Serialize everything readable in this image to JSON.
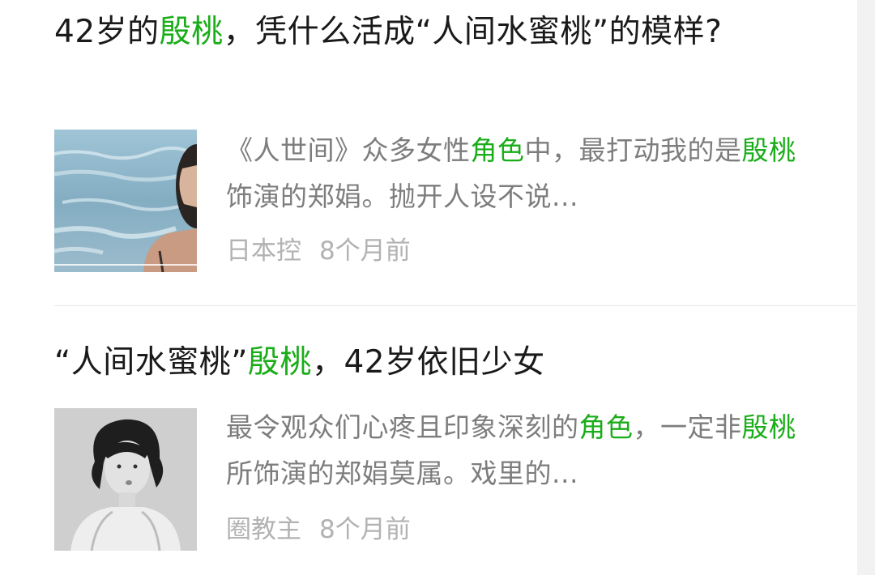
{
  "articles": [
    {
      "title_parts": [
        {
          "text": "42岁的",
          "hl": false
        },
        {
          "text": "殷桃",
          "hl": true
        },
        {
          "text": "，凭什么活成“人间水蜜桃”的模样?",
          "hl": false
        }
      ],
      "summary_parts": [
        {
          "text": "《人世间》众多女性",
          "hl": false
        },
        {
          "text": "角色",
          "hl": true
        },
        {
          "text": "中，最打动我的是",
          "hl": false
        },
        {
          "text": "殷桃",
          "hl": true
        },
        {
          "text": "饰演的郑娟。抛开人设不说...",
          "hl": false
        }
      ],
      "source": "日本控",
      "time": "8个月前",
      "thumb_icon": "beach-photo-thumbnail"
    },
    {
      "title_parts": [
        {
          "text": "“人间水蜜桃”",
          "hl": false
        },
        {
          "text": "殷桃",
          "hl": true
        },
        {
          "text": "，42岁依旧少女",
          "hl": false
        }
      ],
      "summary_parts": [
        {
          "text": "最令观众们心疼且印象深刻的",
          "hl": false
        },
        {
          "text": "角色",
          "hl": true
        },
        {
          "text": "，一定非",
          "hl": false
        },
        {
          "text": "殷桃",
          "hl": true
        },
        {
          "text": "所饰演的郑娟莫属。戏里的...",
          "hl": false
        }
      ],
      "source": "圈教主",
      "time": "8个月前",
      "thumb_icon": "portrait-photo-thumbnail"
    }
  ],
  "colors": {
    "highlight": "#1aad19",
    "title": "#1a1a1a",
    "summary": "#7d7d7d",
    "meta": "#b2b2b2"
  }
}
